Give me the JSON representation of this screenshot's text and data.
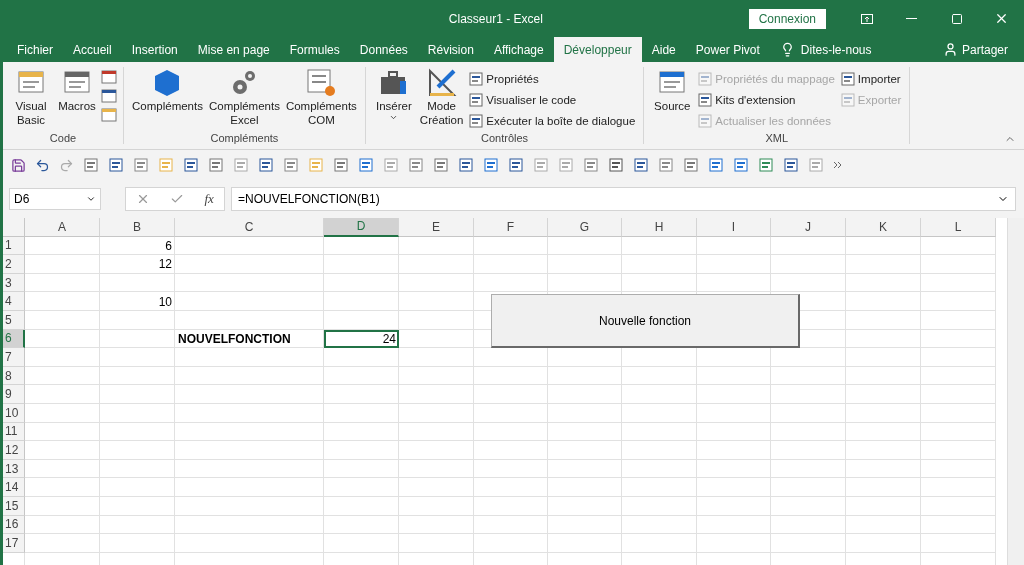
{
  "window": {
    "title": "Classeur1  -  Excel",
    "signin": "Connexion"
  },
  "tabs": [
    {
      "label": "Fichier",
      "selected": false
    },
    {
      "label": "Accueil",
      "selected": false
    },
    {
      "label": "Insertion",
      "selected": false
    },
    {
      "label": "Mise en page",
      "selected": false
    },
    {
      "label": "Formules",
      "selected": false
    },
    {
      "label": "Données",
      "selected": false
    },
    {
      "label": "Révision",
      "selected": false
    },
    {
      "label": "Affichage",
      "selected": false
    },
    {
      "label": "Développeur",
      "selected": true
    },
    {
      "label": "Aide",
      "selected": false
    },
    {
      "label": "Power Pivot",
      "selected": false
    }
  ],
  "tell_me": "Dites-le-nous",
  "share": "Partager",
  "ribbon": [
    {
      "name": "Code",
      "items": [
        {
          "kind": "big",
          "label": "Visual Basic"
        },
        {
          "kind": "big",
          "label": "Macros"
        },
        {
          "kind": "icons"
        }
      ]
    },
    {
      "name": "Compléments",
      "items": [
        {
          "kind": "big",
          "label": "Compléments"
        },
        {
          "kind": "big",
          "label": "Compléments Excel"
        },
        {
          "kind": "big",
          "label": "Compléments COM"
        }
      ]
    },
    {
      "name": "Contrôles",
      "items": [
        {
          "kind": "big",
          "label": "Insérer",
          "dropdown": true
        },
        {
          "kind": "big",
          "label": "Mode Création"
        },
        {
          "kind": "small",
          "buttons": [
            {
              "label": "Propriétés",
              "disabled": false
            },
            {
              "label": "Visualiser le code",
              "disabled": false
            },
            {
              "label": "Exécuter la boîte de dialogue",
              "disabled": false
            }
          ]
        }
      ]
    },
    {
      "name": "XML",
      "items": [
        {
          "kind": "big",
          "label": "Source"
        },
        {
          "kind": "small",
          "buttons": [
            {
              "label": "Propriétés du mappage",
              "disabled": true
            },
            {
              "label": "Kits d'extension",
              "disabled": false
            },
            {
              "label": "Actualiser les données",
              "disabled": true
            }
          ]
        },
        {
          "kind": "small",
          "buttons": [
            {
              "label": "Importer",
              "disabled": false
            },
            {
              "label": "Exporter",
              "disabled": true
            }
          ]
        }
      ]
    }
  ],
  "name_box": "D6",
  "function_label": "fx",
  "formula": "=NOUVELFONCTION(B1)",
  "columns": [
    {
      "label": "A",
      "selected": false
    },
    {
      "label": "B",
      "selected": false
    },
    {
      "label": "C",
      "selected": false
    },
    {
      "label": "D",
      "selected": true
    },
    {
      "label": "E",
      "selected": false
    },
    {
      "label": "F",
      "selected": false
    },
    {
      "label": "G",
      "selected": false
    },
    {
      "label": "H",
      "selected": false
    },
    {
      "label": "I",
      "selected": false
    },
    {
      "label": "J",
      "selected": false
    },
    {
      "label": "K",
      "selected": false
    },
    {
      "label": "L",
      "selected": false
    }
  ],
  "rows": [
    {
      "number": "1",
      "selected": false,
      "cells": {
        "B": {
          "kind": "number",
          "text": "6",
          "bold": false,
          "selected": false
        }
      }
    },
    {
      "number": "2",
      "selected": false,
      "cells": {
        "B": {
          "kind": "number",
          "text": "12",
          "bold": false,
          "selected": false
        }
      }
    },
    {
      "number": "3",
      "selected": false,
      "cells": []
    },
    {
      "number": "4",
      "selected": false,
      "cells": {
        "B": {
          "kind": "number",
          "text": "10",
          "bold": false,
          "selected": false
        }
      }
    },
    {
      "number": "5",
      "selected": false,
      "cells": []
    },
    {
      "number": "6",
      "selected": true,
      "cells": {
        "C": {
          "kind": "text",
          "text": "NOUVELFONCTION",
          "bold": true,
          "selected": false
        },
        "D": {
          "kind": "number",
          "text": "24",
          "bold": false,
          "selected": true
        }
      }
    },
    {
      "number": "7",
      "selected": false,
      "cells": []
    },
    {
      "number": "8",
      "selected": false,
      "cells": []
    },
    {
      "number": "9",
      "selected": false,
      "cells": []
    },
    {
      "number": "10",
      "selected": false,
      "cells": []
    },
    {
      "number": "11",
      "selected": false,
      "cells": []
    },
    {
      "number": "12",
      "selected": false,
      "cells": []
    },
    {
      "number": "13",
      "selected": false,
      "cells": []
    },
    {
      "number": "14",
      "selected": false,
      "cells": []
    },
    {
      "number": "15",
      "selected": false,
      "cells": []
    },
    {
      "number": "16",
      "selected": false,
      "cells": []
    },
    {
      "number": "17",
      "selected": false,
      "cells": []
    }
  ],
  "sheet_button": {
    "label": "Nouvelle fonction"
  }
}
